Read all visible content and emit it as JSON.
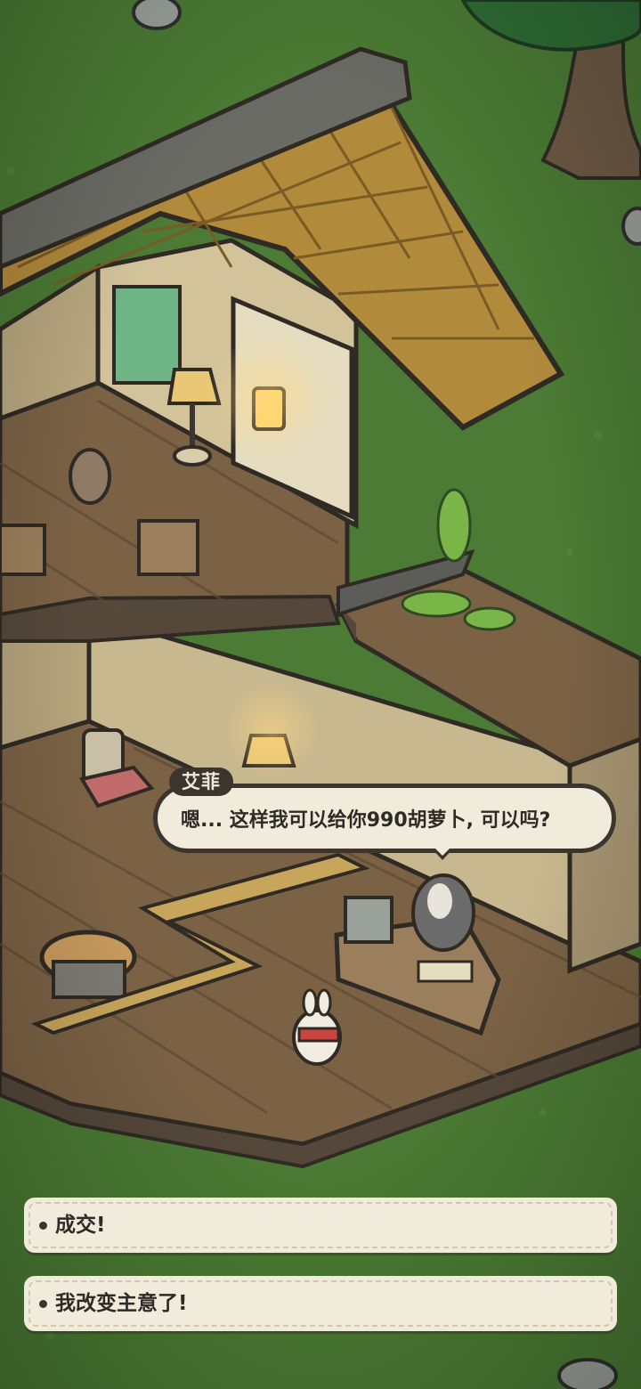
{
  "dialogue": {
    "speaker": "艾菲",
    "line": "嗯... 这样我可以给你990胡萝卜, 可以吗?"
  },
  "choices": [
    {
      "label": "成交!"
    },
    {
      "label": "我改变主意了!"
    }
  ],
  "colors": {
    "grass": "#4a7a33",
    "bubble_fill": "#f1ebdc",
    "bubble_border": "#3b3530",
    "text": "#2e2a26"
  }
}
